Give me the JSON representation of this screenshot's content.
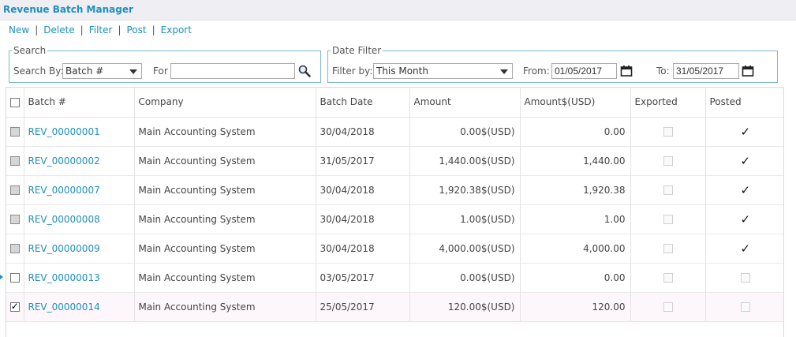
{
  "app": {
    "title": "Revenue Batch Manager"
  },
  "toolbar": {
    "new_label": "New",
    "delete_label": "Delete",
    "filter_label": "Filter",
    "post_label": "Post",
    "export_label": "Export"
  },
  "search": {
    "legend": "Search",
    "search_by_label": "Search By:",
    "search_by_value": "Batch #",
    "for_label": "For",
    "for_value": ""
  },
  "date_filter": {
    "legend": "Date Filter",
    "filter_by_label": "Filter by:",
    "filter_by_value": "This Month",
    "from_label": "From:",
    "from_value": "01/05/2017",
    "to_label": "To:",
    "to_value": "31/05/2017"
  },
  "table": {
    "headers": [
      "Batch #",
      "Company",
      "Batch Date",
      "Amount",
      "Amount$(USD)",
      "Exported",
      "Posted"
    ],
    "rows": [
      {
        "batch": "REV_00000001",
        "company": "Main Accounting System",
        "date": "30/04/2018",
        "amount": "0.00$(USD)",
        "amount_usd": "0.00",
        "posted": true,
        "checked": false
      },
      {
        "batch": "REV_00000002",
        "company": "Main Accounting System",
        "date": "31/05/2017",
        "amount": "1,440.00$(USD)",
        "amount_usd": "1,440.00",
        "posted": true,
        "checked": false
      },
      {
        "batch": "REV_00000007",
        "company": "Main Accounting System",
        "date": "30/04/2018",
        "amount": "1,920.38$(USD)",
        "amount_usd": "1,920.38",
        "posted": true,
        "checked": false
      },
      {
        "batch": "REV_00000008",
        "company": "Main Accounting System",
        "date": "30/04/2018",
        "amount": "1.00$(USD)",
        "amount_usd": "1.00",
        "posted": true,
        "checked": false
      },
      {
        "batch": "REV_00000009",
        "company": "Main Accounting System",
        "date": "30/04/2018",
        "amount": "4,000.00$(USD)",
        "amount_usd": "4,000.00",
        "posted": true,
        "checked": false
      },
      {
        "batch": "REV_00000013",
        "company": "Main Accounting System",
        "date": "03/05/2017",
        "amount": "0.00$(USD)",
        "amount_usd": "0.00",
        "posted": false,
        "checked": false
      },
      {
        "batch": "REV_00000014",
        "company": "Main Accounting System",
        "date": "25/05/2017",
        "amount": "120.00$(USD)",
        "amount_usd": "120.00",
        "posted": false,
        "checked": true
      }
    ]
  },
  "icons": {
    "search": "magnifier-icon",
    "calendar": "calendar-icon",
    "dropdown": "chevron-down-icon"
  },
  "colors": {
    "accent": "#1e8fbf",
    "border": "#7cb7cf"
  }
}
